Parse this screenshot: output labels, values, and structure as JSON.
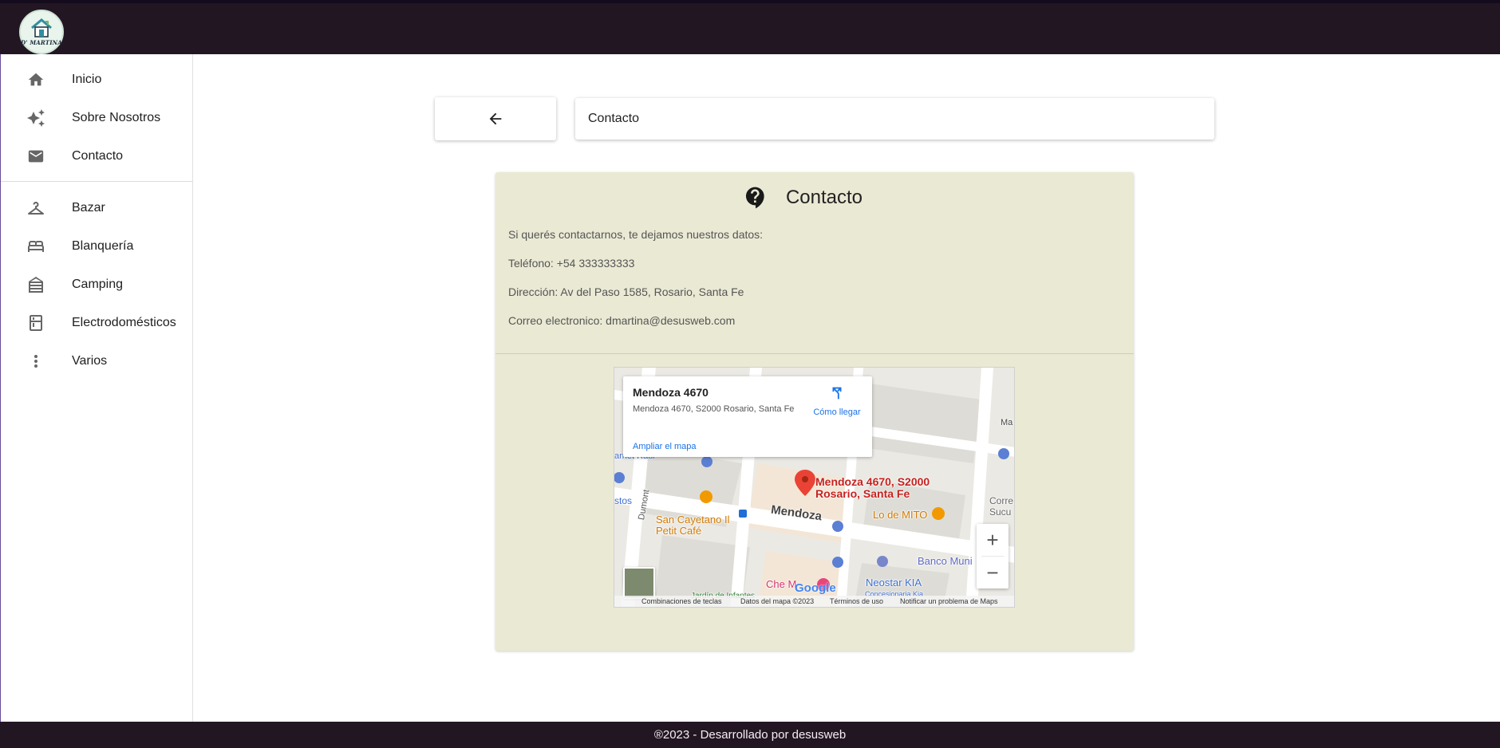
{
  "header": {
    "logo_text": "D' MARTINA"
  },
  "sidebar": {
    "items": [
      {
        "label": "Inicio",
        "icon": "home-icon"
      },
      {
        "label": "Sobre Nosotros",
        "icon": "sparkles-icon"
      },
      {
        "label": "Contacto",
        "icon": "mail-icon"
      },
      {
        "label": "Bazar",
        "icon": "hanger-icon"
      },
      {
        "label": "Blanquería",
        "icon": "bed-icon"
      },
      {
        "label": "Camping",
        "icon": "tent-icon"
      },
      {
        "label": "Electrodomésticos",
        "icon": "kitchen-icon"
      },
      {
        "label": "Varios",
        "icon": "more-vert-icon"
      }
    ]
  },
  "page": {
    "back_icon": "arrow-left-icon",
    "title": "Contacto"
  },
  "card": {
    "icon": "question-bubble-icon",
    "title": "Contacto",
    "lines": [
      "Si querés contactarnos, te dejamos nuestros datos:",
      "Teléfono: +54 333333333",
      "Dirección: Av del Paso 1585, Rosario, Santa Fe",
      "Correo electronico: dmartina@desusweb.com"
    ]
  },
  "map": {
    "popup": {
      "name": "Mendoza 4670",
      "address": "Mendoza 4670, S2000 Rosario, Santa Fe",
      "directions": "Cómo llegar",
      "enlarge": "Ampliar el mapa"
    },
    "pin_label": "Mendoza 4670, S2000 Rosario, Santa Fe",
    "labels": {
      "street": "Mendoza",
      "dumont": "Dumont",
      "cafe": "San Cayetano Il Petit Café",
      "lodemito": "Lo de MITO",
      "banco": "Banco Muni",
      "neostar": "Neostar KIA",
      "neostar_sub": "Concesionaria Kia",
      "che": "Che M",
      "rauf": "arnet Raul",
      "stos": "stos",
      "corre": "Corre Sucu",
      "jardin": "Jardín de Infantes",
      "ma": "Ma"
    },
    "zoom_in": "+",
    "zoom_out": "−",
    "google": "Google",
    "footer": {
      "shortcuts": "Combinaciones de teclas",
      "data": "Datos del mapa ©2023",
      "terms": "Términos de uso",
      "report": "Notificar un problema de Maps"
    }
  },
  "footer": {
    "text": "®2023 - Desarrollado por desusweb"
  },
  "colors": {
    "topbar": "#231623",
    "card_bg": "#eae9d4",
    "pin": "#ea4335",
    "link": "#1a73e8"
  }
}
